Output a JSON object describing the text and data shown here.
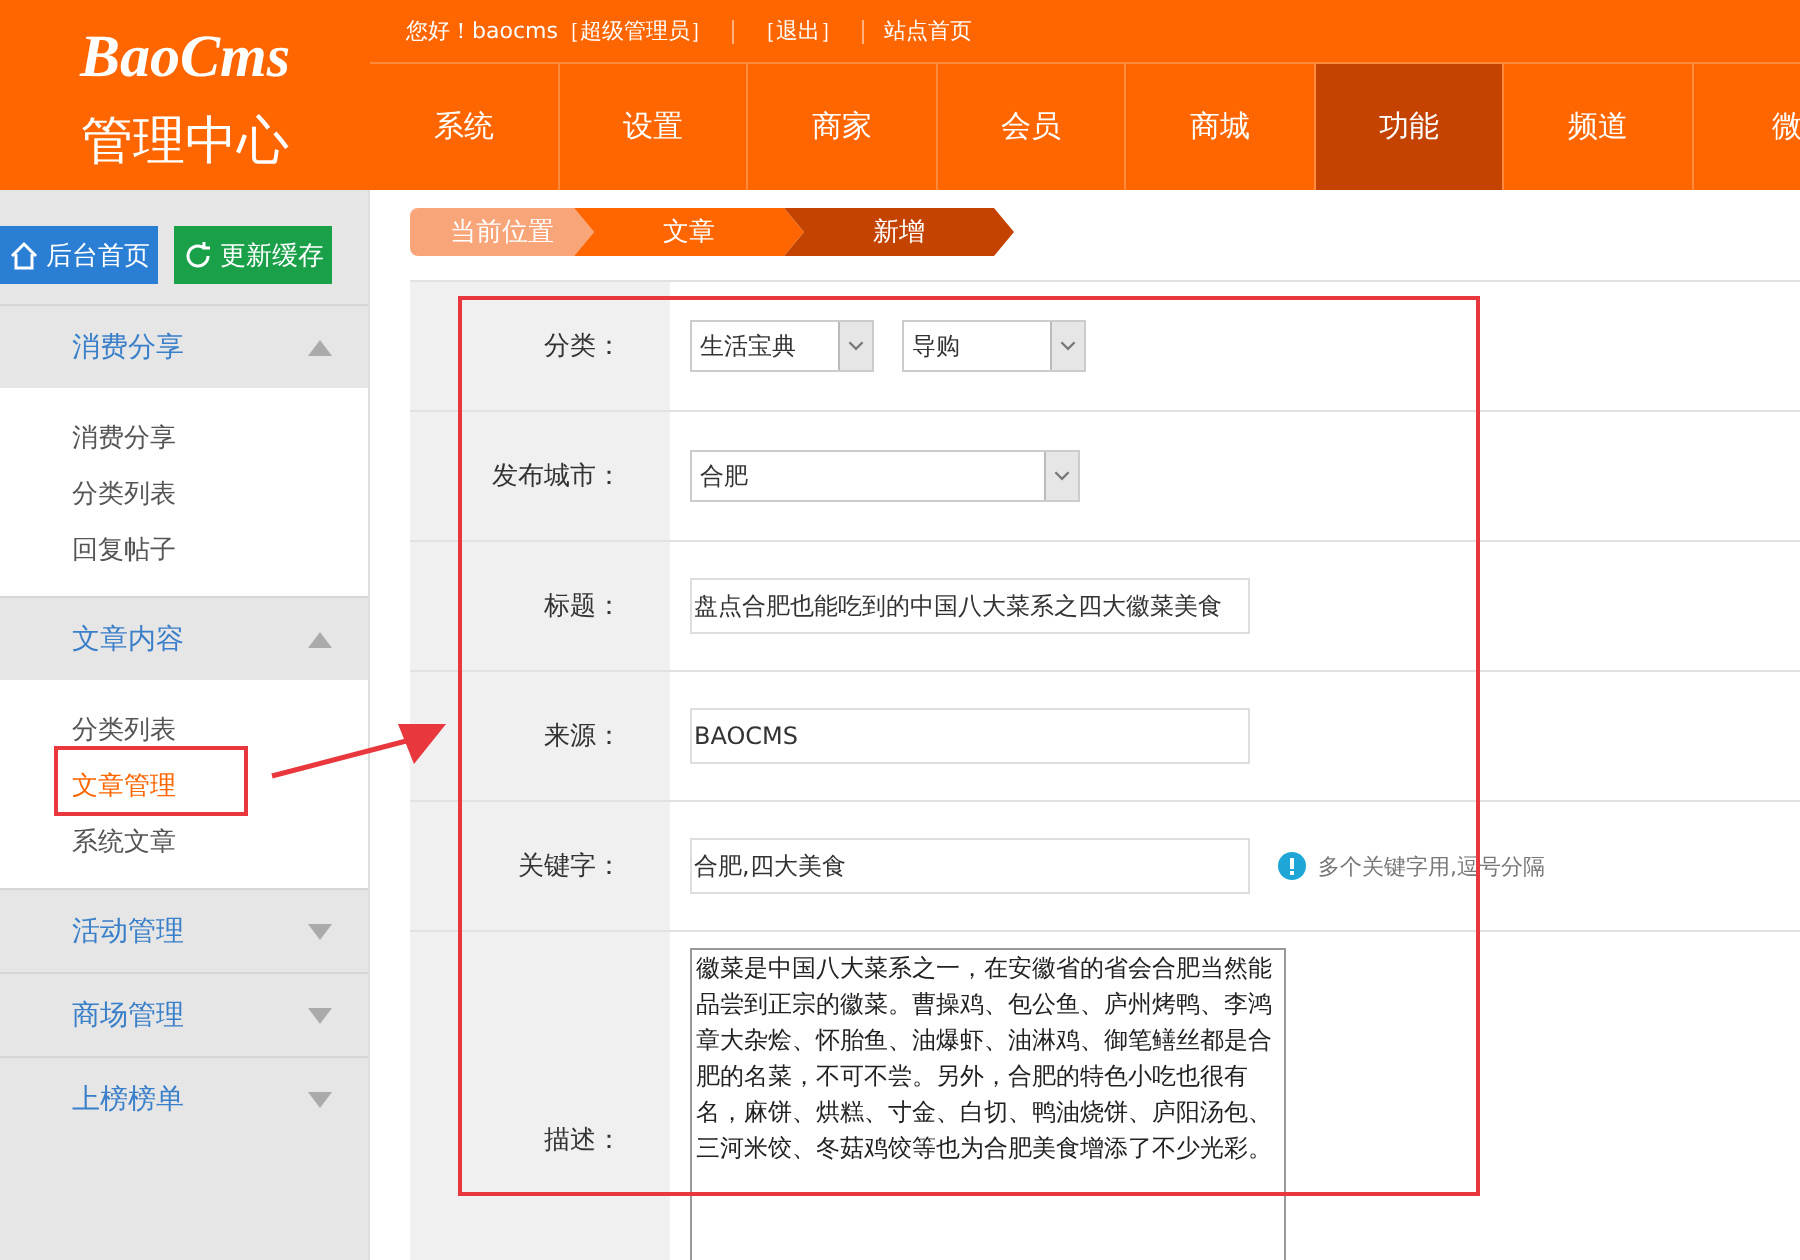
{
  "brand": {
    "logo": "BaoCms",
    "subtitle": "管理中心"
  },
  "top_bar": {
    "greeting": "您好！baocms［超级管理员］",
    "links": [
      "［退出］",
      "站点首页"
    ]
  },
  "nav": [
    {
      "label": "系统",
      "selected": false
    },
    {
      "label": "设置",
      "selected": false
    },
    {
      "label": "商家",
      "selected": false
    },
    {
      "label": "会员",
      "selected": false
    },
    {
      "label": "商城",
      "selected": false
    },
    {
      "label": "功能",
      "selected": true
    },
    {
      "label": "频道",
      "selected": false
    },
    {
      "label": "微",
      "selected": false
    }
  ],
  "sidebar": {
    "buttons": [
      {
        "kind": "home",
        "label": "后台首页"
      },
      {
        "kind": "refresh",
        "label": "更新缓存"
      }
    ],
    "groups": [
      {
        "title": "消费分享",
        "expanded": true,
        "items": [
          {
            "label": "消费分享",
            "selected": false
          },
          {
            "label": "分类列表",
            "selected": false
          },
          {
            "label": "回复帖子",
            "selected": false
          }
        ]
      },
      {
        "title": "文章内容",
        "expanded": true,
        "items": [
          {
            "label": "分类列表",
            "selected": false
          },
          {
            "label": "文章管理",
            "selected": true
          },
          {
            "label": "系统文章",
            "selected": false
          }
        ]
      },
      {
        "title": "活动管理",
        "expanded": false
      },
      {
        "title": "商场管理",
        "expanded": false
      },
      {
        "title": "上榜榜单",
        "expanded": false
      }
    ]
  },
  "breadcrumb": [
    "当前位置",
    "文章",
    "新增"
  ],
  "form": [
    {
      "kind": "selects",
      "label": "分类：",
      "values": [
        "生活宝典",
        "导购"
      ]
    },
    {
      "kind": "select",
      "label": "发布城市：",
      "value": "合肥"
    },
    {
      "kind": "input",
      "label": "标题：",
      "value": "盘点合肥也能吃到的中国八大菜系之四大徽菜美食"
    },
    {
      "kind": "input",
      "label": "来源：",
      "value": "BAOCMS"
    },
    {
      "kind": "input",
      "label": "关键字：",
      "value": "合肥,四大美食",
      "hint": "多个关键字用,逗号分隔"
    },
    {
      "kind": "textarea",
      "label": "描述：",
      "value": "徽菜是中国八大菜系之一，在安徽省的省会合肥当然能品尝到正宗的徽菜。曹操鸡、包公鱼、庐州烤鸭、李鸿章大杂烩、怀胎鱼、油爆虾、油淋鸡、御笔鳝丝都是合肥的名菜，不可不尝。另外，合肥的特色小吃也很有名，麻饼、烘糕、寸金、白切、鸭油烧饼、庐阳汤包、三河米饺、冬菇鸡饺等也为合肥美食增添了不少光彩。"
    }
  ]
}
